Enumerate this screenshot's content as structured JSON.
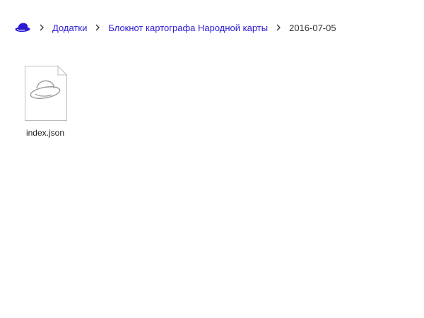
{
  "breadcrumb": {
    "home_icon": "saucer-logo-icon",
    "separator_icon": "chevron-right-icon",
    "items": [
      {
        "label": "Додатки"
      },
      {
        "label": "Блокнот картографа Народной карты"
      }
    ],
    "current": "2016-07-05"
  },
  "files": [
    {
      "name": "index.json",
      "icon": "file-saucer-icon"
    }
  ],
  "colors": {
    "link": "#2b1bd1",
    "text": "#333333",
    "icon_gray": "#9a9a9a"
  }
}
